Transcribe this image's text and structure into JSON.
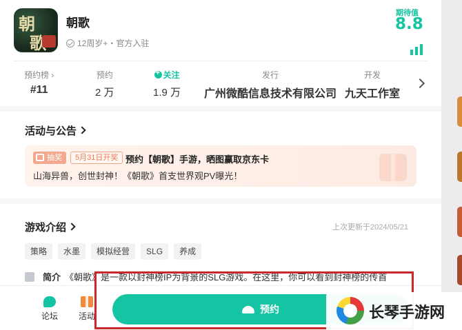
{
  "header": {
    "title": "朝歌",
    "icon_chars": [
      "朝",
      "歌"
    ],
    "subtitle": "12周岁+・官方入驻",
    "score_label": "期待值",
    "score_value": "8.8"
  },
  "stats": [
    {
      "label": "预约榜 ›",
      "value": "#11"
    },
    {
      "label": "预约",
      "value": "2 万"
    },
    {
      "label": "关注",
      "value": "1.9 万"
    },
    {
      "label": "发行",
      "value": "广州微酷信息技术有限公司"
    },
    {
      "label": "开发",
      "value": "九天工作室"
    }
  ],
  "events": {
    "title": "活动与公告",
    "tag": "抽奖",
    "date": "5月31日开奖",
    "headline": "预约【朝歌】手游，晒图赢取京东卡",
    "desc": "山海异兽，创世封神！《朝歌》首支世界观PV曝光！"
  },
  "intro": {
    "title": "游戏介绍",
    "updated": "上次更新于2024/05/21",
    "tags": [
      "策略",
      "水墨",
      "模拟经营",
      "SLG",
      "养成"
    ],
    "summary_label": "简介",
    "summary": "《朝歌》是一款以封神榜IP为背景的SLG游戏。在这里，你可以看到封神榜的传首"
  },
  "bottom": {
    "forum": "论坛",
    "activity": "活动",
    "reserve": "预约"
  },
  "watermark": "长琴手游网",
  "colors": {
    "accent": "#14c4a3",
    "highlight_box": "#c8282a"
  }
}
